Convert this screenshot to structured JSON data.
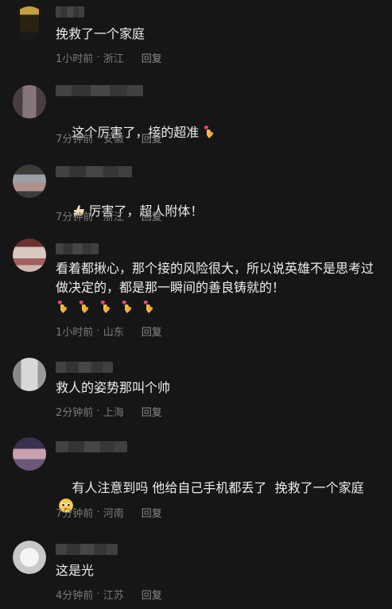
{
  "comments": [
    {
      "text": "挽救了一个家庭",
      "time": "1小时前",
      "location": "浙江",
      "reply": "回复",
      "avatar_colors": [
        "#1b1b1b",
        "#c09a3a",
        "#2a2210"
      ]
    },
    {
      "text": "这个厉害了，接的超准",
      "time": "7分钟前",
      "location": "安徽",
      "reply": "回复",
      "avatar_colors": [
        "#5a4a4d",
        "#8d7c80",
        "#3a3033"
      ]
    },
    {
      "text": "厉害了，超人附体！",
      "time": "7分钟前",
      "location": "浙江",
      "reply": "回复",
      "avatar_colors": [
        "#3b3b3b",
        "#9aa0a8",
        "#b0908a"
      ]
    },
    {
      "text": "看着都揪心，那个接的风险很大，所以说英雄不是思考过做决定的，都是那一瞬间的善良铸就的！",
      "time": "1小时前",
      "location": "山东",
      "reply": "回复",
      "avatar_colors": [
        "#6b3030",
        "#d8c8c0",
        "#a06060"
      ]
    },
    {
      "text": "救人的姿势那叫个帅",
      "time": "2分钟前",
      "location": "上海",
      "reply": "回复",
      "avatar_colors": [
        "#d8d8d8",
        "#8a8a8a",
        "#b8b8b8"
      ]
    },
    {
      "text": "有人注意到吗 他给自己手机都丢了  挽救了一个家庭",
      "time": "7分钟前",
      "location": "河南",
      "reply": "回复",
      "avatar_colors": [
        "#3a3050",
        "#c8a0b0",
        "#6a5878"
      ]
    },
    {
      "text": "这是光",
      "time": "4分钟前",
      "location": "江苏",
      "reply": "回复",
      "avatar_colors": [
        "#e8e8e8",
        "#c8c8c8",
        "#f4f4f4"
      ]
    }
  ],
  "emoji_names": {
    "heart_hands": "heart-hands-emoji",
    "thumbs_up": "thumbs-up-emoji",
    "pleading": "pleading-face-emoji"
  }
}
